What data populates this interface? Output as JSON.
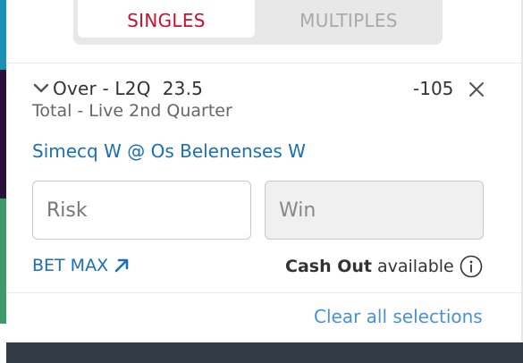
{
  "tabs": [
    {
      "label": "SINGLES",
      "active": true
    },
    {
      "label": "MULTIPLES",
      "active": false
    }
  ],
  "selection": {
    "name": "Over - L2Q  23.5",
    "odds": "-105",
    "market": "Total - Live 2nd Quarter",
    "event": "Simecq W @ Os Belenenses W"
  },
  "inputs": {
    "risk_placeholder": "Risk",
    "win_placeholder": "Win"
  },
  "actions": {
    "bet_max": "BET MAX",
    "cash_out_bold": "Cash Out",
    "cash_out_rest": "available",
    "clear_all": "Clear all selections"
  },
  "icons": {
    "chevron": "chevron-down-icon",
    "close": "close-icon",
    "arrow": "arrow-up-right-icon",
    "info": "info-icon"
  },
  "colors": {
    "active_tab_text": "#c8102e",
    "link_blue": "#1a6fb5",
    "clear_blue": "#4a90d9",
    "footer": "#333b46"
  }
}
